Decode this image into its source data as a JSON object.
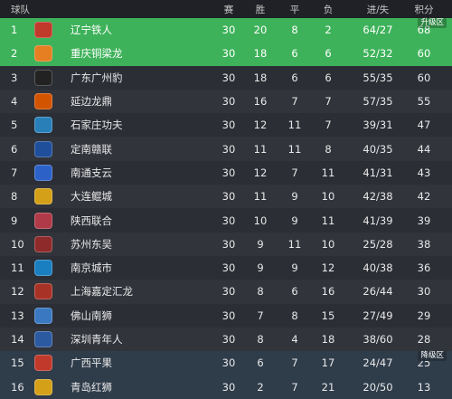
{
  "header": {
    "team": "球队",
    "played": "赛",
    "won": "胜",
    "drawn": "平",
    "lost": "负",
    "goals": "进/失",
    "points": "积分"
  },
  "zones": {
    "promotion": "升级区",
    "relegation": "降级区"
  },
  "rows": [
    {
      "rank": "1",
      "team": "辽宁铁人",
      "played": "30",
      "won": "20",
      "drawn": "8",
      "lost": "2",
      "goals": "64/27",
      "points": "68",
      "logo_color": "#c0392b",
      "zone": "promo",
      "badge": "升级区"
    },
    {
      "rank": "2",
      "team": "重庆铜梁龙",
      "played": "30",
      "won": "18",
      "drawn": "6",
      "lost": "6",
      "goals": "52/32",
      "points": "60",
      "logo_color": "#e67e22",
      "zone": "promo"
    },
    {
      "rank": "3",
      "team": "广东广州豹",
      "played": "30",
      "won": "18",
      "drawn": "6",
      "lost": "6",
      "goals": "55/35",
      "points": "60",
      "logo_color": "#222222",
      "zone": "odd"
    },
    {
      "rank": "4",
      "team": "延边龙鼎",
      "played": "30",
      "won": "16",
      "drawn": "7",
      "lost": "7",
      "goals": "57/35",
      "points": "55",
      "logo_color": "#d35400",
      "zone": "even"
    },
    {
      "rank": "5",
      "team": "石家庄功夫",
      "played": "30",
      "won": "12",
      "drawn": "11",
      "lost": "7",
      "goals": "39/31",
      "points": "47",
      "logo_color": "#2980b9",
      "zone": "odd"
    },
    {
      "rank": "6",
      "team": "定南赣联",
      "played": "30",
      "won": "11",
      "drawn": "11",
      "lost": "8",
      "goals": "40/35",
      "points": "44",
      "logo_color": "#1f4e9a",
      "zone": "even"
    },
    {
      "rank": "7",
      "team": "南通支云",
      "played": "30",
      "won": "12",
      "drawn": "7",
      "lost": "11",
      "goals": "41/31",
      "points": "43",
      "logo_color": "#2c62c8",
      "zone": "odd"
    },
    {
      "rank": "8",
      "team": "大连鲲城",
      "played": "30",
      "won": "11",
      "drawn": "9",
      "lost": "10",
      "goals": "42/38",
      "points": "42",
      "logo_color": "#d4a017",
      "zone": "even"
    },
    {
      "rank": "9",
      "team": "陕西联合",
      "played": "30",
      "won": "10",
      "drawn": "9",
      "lost": "11",
      "goals": "41/39",
      "points": "39",
      "logo_color": "#b03a48",
      "zone": "odd"
    },
    {
      "rank": "10",
      "team": "苏州东吴",
      "played": "30",
      "won": "9",
      "drawn": "11",
      "lost": "10",
      "goals": "25/28",
      "points": "38",
      "logo_color": "#8e2a2a",
      "zone": "even"
    },
    {
      "rank": "11",
      "team": "南京城市",
      "played": "30",
      "won": "9",
      "drawn": "9",
      "lost": "12",
      "goals": "40/38",
      "points": "36",
      "logo_color": "#1a7fc1",
      "zone": "odd"
    },
    {
      "rank": "12",
      "team": "上海嘉定汇龙",
      "played": "30",
      "won": "8",
      "drawn": "6",
      "lost": "16",
      "goals": "26/44",
      "points": "30",
      "logo_color": "#a93226",
      "zone": "even"
    },
    {
      "rank": "13",
      "team": "佛山南狮",
      "played": "30",
      "won": "7",
      "drawn": "8",
      "lost": "15",
      "goals": "27/49",
      "points": "29",
      "logo_color": "#3a78c2",
      "zone": "odd"
    },
    {
      "rank": "14",
      "team": "深圳青年人",
      "played": "30",
      "won": "8",
      "drawn": "4",
      "lost": "18",
      "goals": "38/60",
      "points": "28",
      "logo_color": "#2c5aa0",
      "zone": "even"
    },
    {
      "rank": "15",
      "team": "广西平果",
      "played": "30",
      "won": "6",
      "drawn": "7",
      "lost": "17",
      "goals": "24/47",
      "points": "25",
      "logo_color": "#c0392b",
      "zone": "releg",
      "badge": "降级区"
    },
    {
      "rank": "16",
      "team": "青岛红狮",
      "played": "30",
      "won": "2",
      "drawn": "7",
      "lost": "21",
      "goals": "20/50",
      "points": "13",
      "logo_color": "#d4a017",
      "zone": "releg"
    }
  ]
}
